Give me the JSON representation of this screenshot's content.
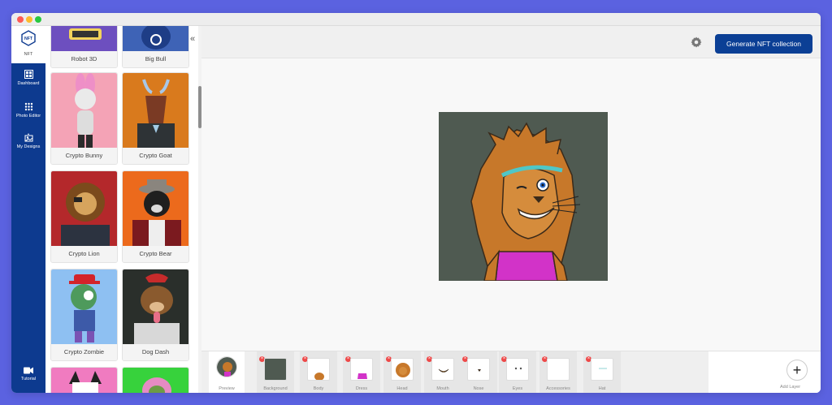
{
  "app": {
    "logo_text": "NFT",
    "logo_label": "NFT"
  },
  "rail": {
    "items": [
      {
        "label": "Dashboard",
        "icon": "dashboard-icon"
      },
      {
        "label": "Photo Editor",
        "icon": "photo-editor-icon"
      },
      {
        "label": "My Designs",
        "icon": "my-designs-icon"
      }
    ],
    "tutorial": {
      "label": "Tutorial",
      "icon": "video-icon"
    }
  },
  "catalog": {
    "collapse_icon": "double-chevron-left-icon",
    "cards": [
      {
        "label": "Robot 3D",
        "bg": "#6d4fbf"
      },
      {
        "label": "Big Bull",
        "bg": "#3e63b6"
      },
      {
        "label": "Crypto Bunny",
        "bg": "#f4a3b6"
      },
      {
        "label": "Crypto Goat",
        "bg": "#d97a1d"
      },
      {
        "label": "Crypto Lion",
        "bg": "#b4282b"
      },
      {
        "label": "Crypto Bear",
        "bg": "#ec6a1c"
      },
      {
        "label": "Crypto Zombie",
        "bg": "#8ec0f2"
      },
      {
        "label": "Dog Dash",
        "bg": "#2a2f2b"
      },
      {
        "label": "",
        "bg": "#f07bc0"
      },
      {
        "label": "",
        "bg": "#37d23c"
      }
    ]
  },
  "toolbar": {
    "settings_icon": "gear-icon",
    "generate_label": "Generate NFT collection",
    "accent": "#0b3f95"
  },
  "canvas": {
    "background": "#4f5a51"
  },
  "layers": {
    "preview_label": "Preview",
    "items": [
      {
        "label": "Background"
      },
      {
        "label": "Body"
      },
      {
        "label": "Dress"
      },
      {
        "label": "Head"
      },
      {
        "label": "Mouth"
      },
      {
        "label": "Nose"
      },
      {
        "label": "Eyes"
      },
      {
        "label": "Accessories"
      },
      {
        "label": "Hat"
      }
    ],
    "add_label": "Add Layer"
  }
}
